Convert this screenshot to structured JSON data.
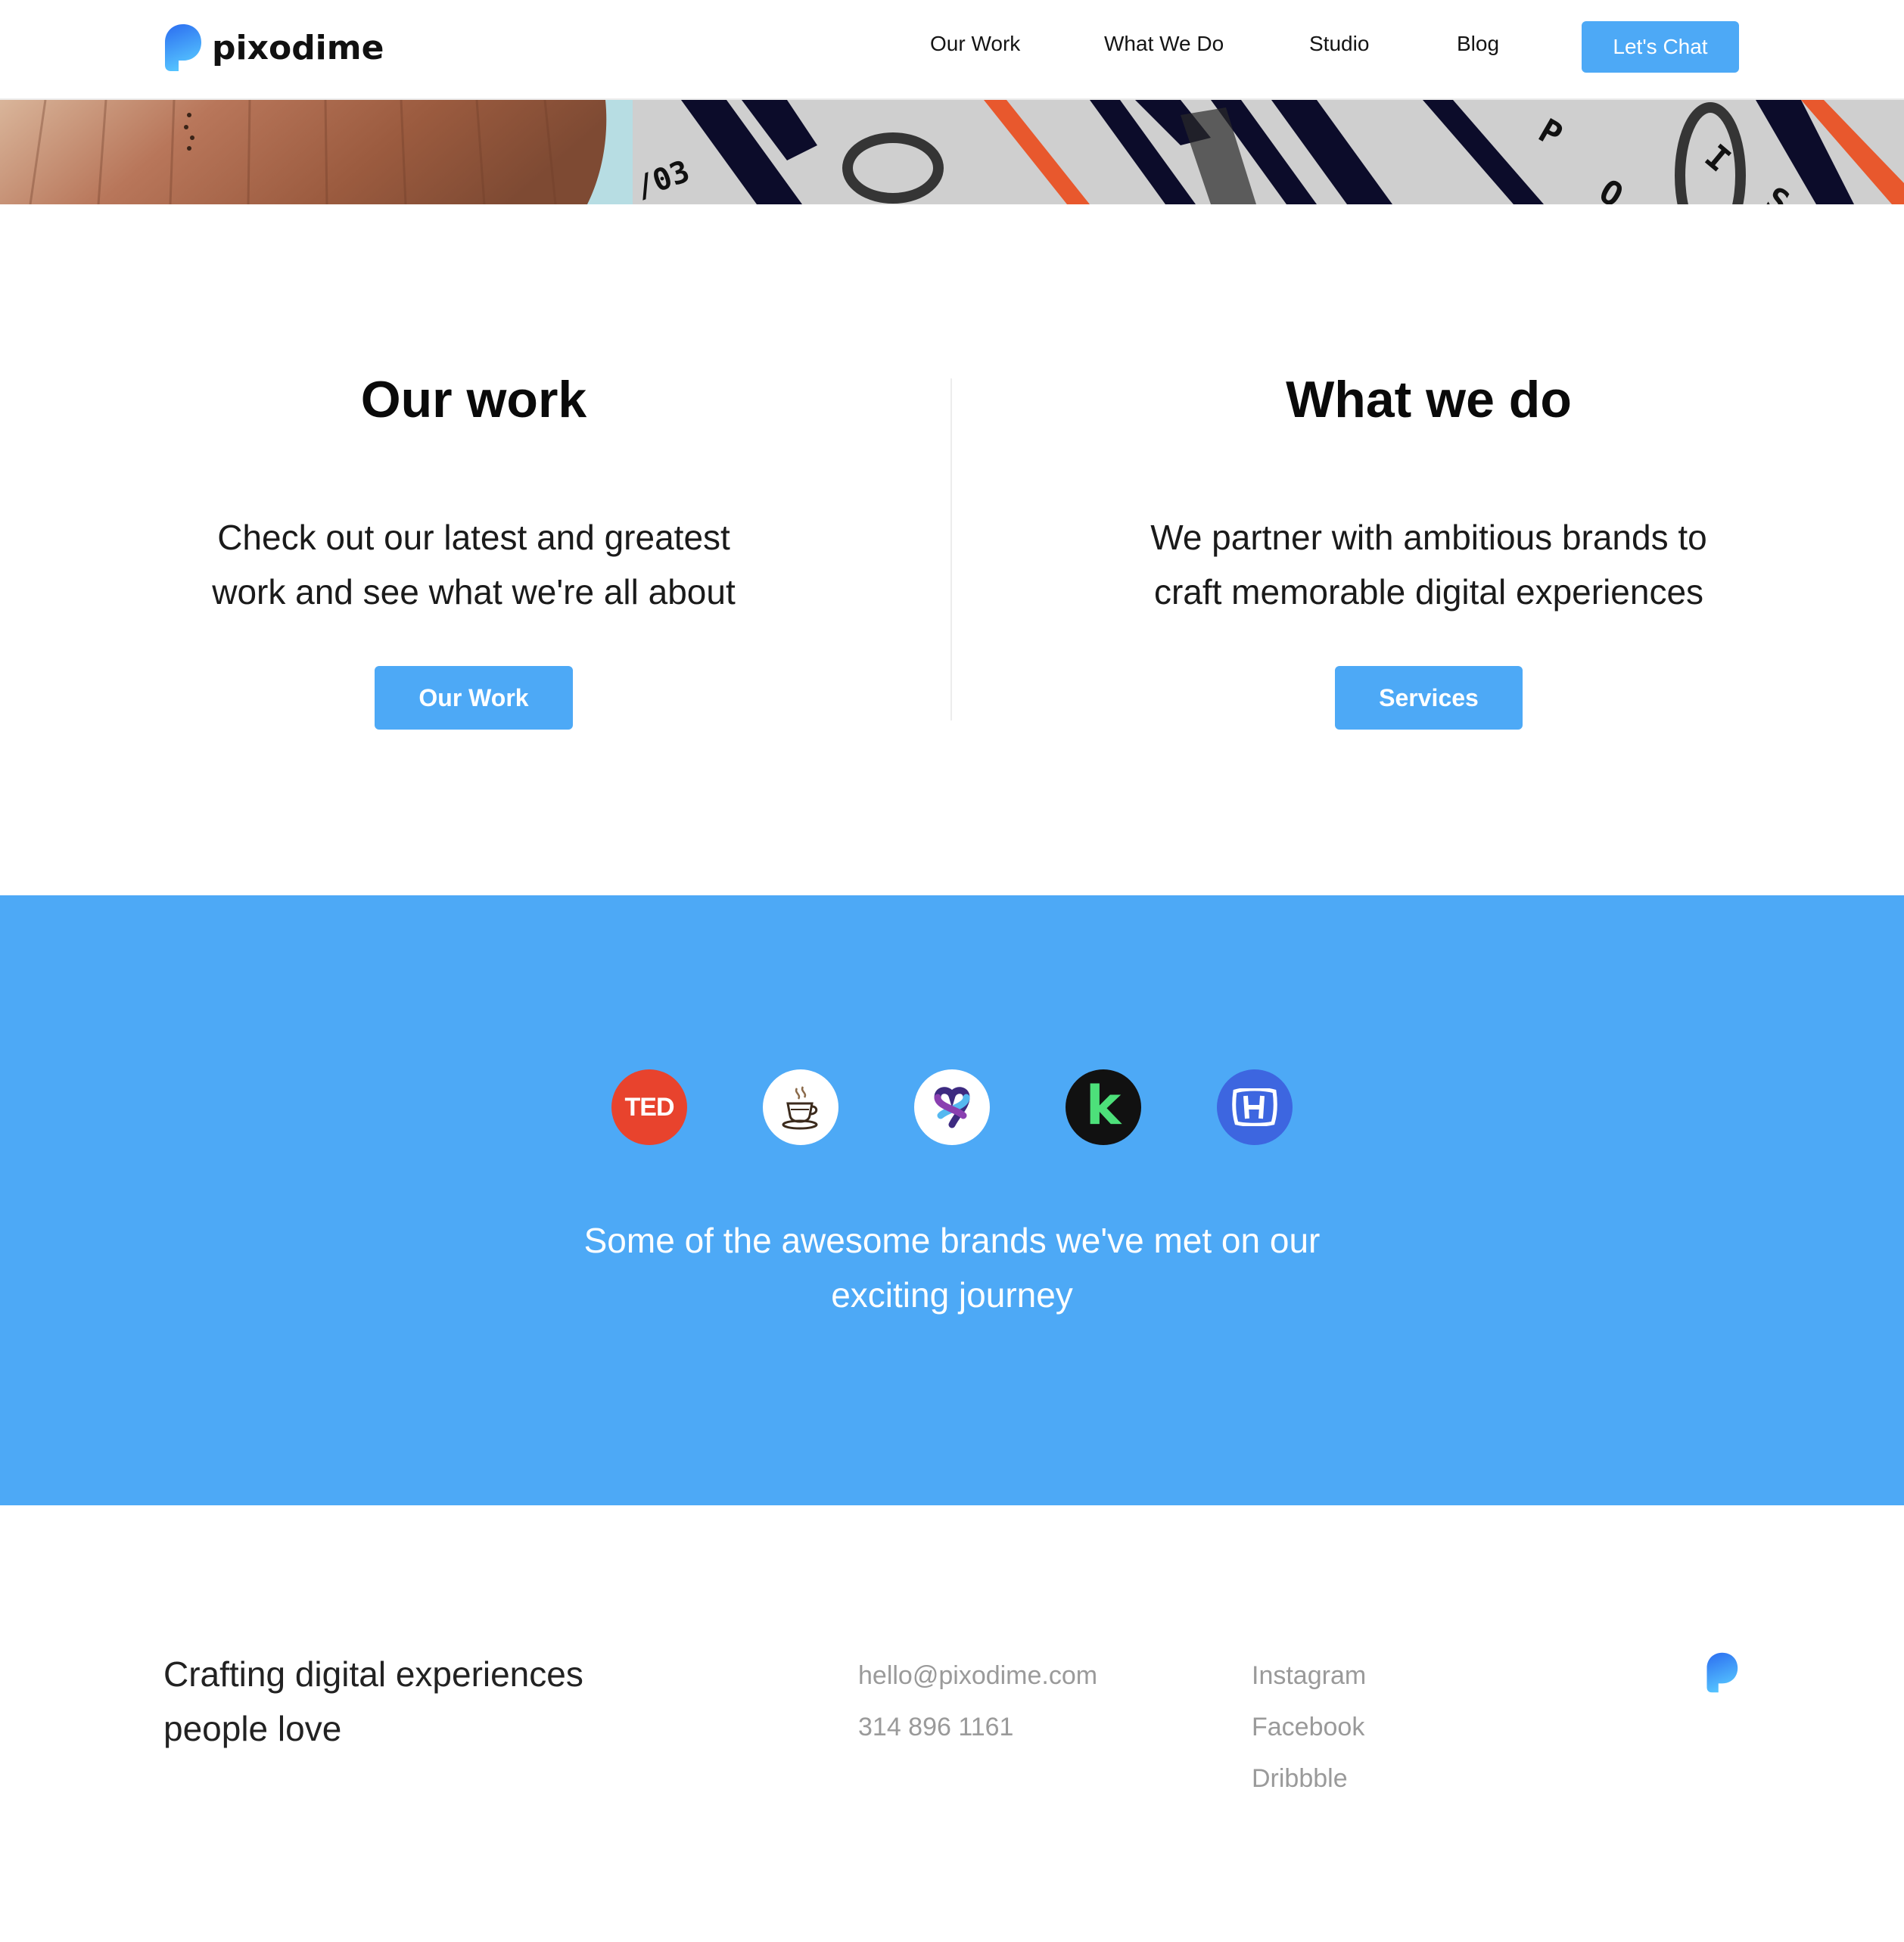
{
  "header": {
    "logo_text": "pixodime",
    "nav": [
      {
        "label": "Our Work"
      },
      {
        "label": "What We Do"
      },
      {
        "label": "Studio"
      },
      {
        "label": "Blog"
      }
    ],
    "cta_label": "Let's Chat"
  },
  "banner": {
    "text_fragments": [
      "/03",
      "P",
      "I",
      "O",
      "S"
    ]
  },
  "intro": {
    "left": {
      "title": "Our work",
      "text_line1": "Check out our latest and greatest",
      "text_line2": "work and see what we're all about",
      "button_label": "Our Work"
    },
    "right": {
      "title": "What we do",
      "text_line1": "We partner with ambitious brands to",
      "text_line2": "craft memorable digital experiences",
      "button_label": "Services"
    }
  },
  "brands": {
    "logos": [
      {
        "name": "ted-logo",
        "label": "TED",
        "bg": "#e8432d"
      },
      {
        "name": "coffee-logo",
        "bg": "#ffffff"
      },
      {
        "name": "heart-logo",
        "bg": "#ffffff"
      },
      {
        "name": "k-logo",
        "label": "k",
        "bg": "#111111"
      },
      {
        "name": "honda-logo",
        "bg": "#3d66e0"
      }
    ],
    "caption_line1": "Some of the awesome brands we've met on our",
    "caption_line2": "exciting journey"
  },
  "footer": {
    "tagline_line1": "Crafting digital experiences",
    "tagline_line2": "people love",
    "email": "hello@pixodime.com",
    "phone": "314 896 1161",
    "social": [
      "Instagram",
      "Facebook",
      "Dribbble"
    ]
  },
  "colors": {
    "accent": "#4da9f6",
    "text": "#0d0d0d",
    "muted": "#9a9a9a"
  }
}
